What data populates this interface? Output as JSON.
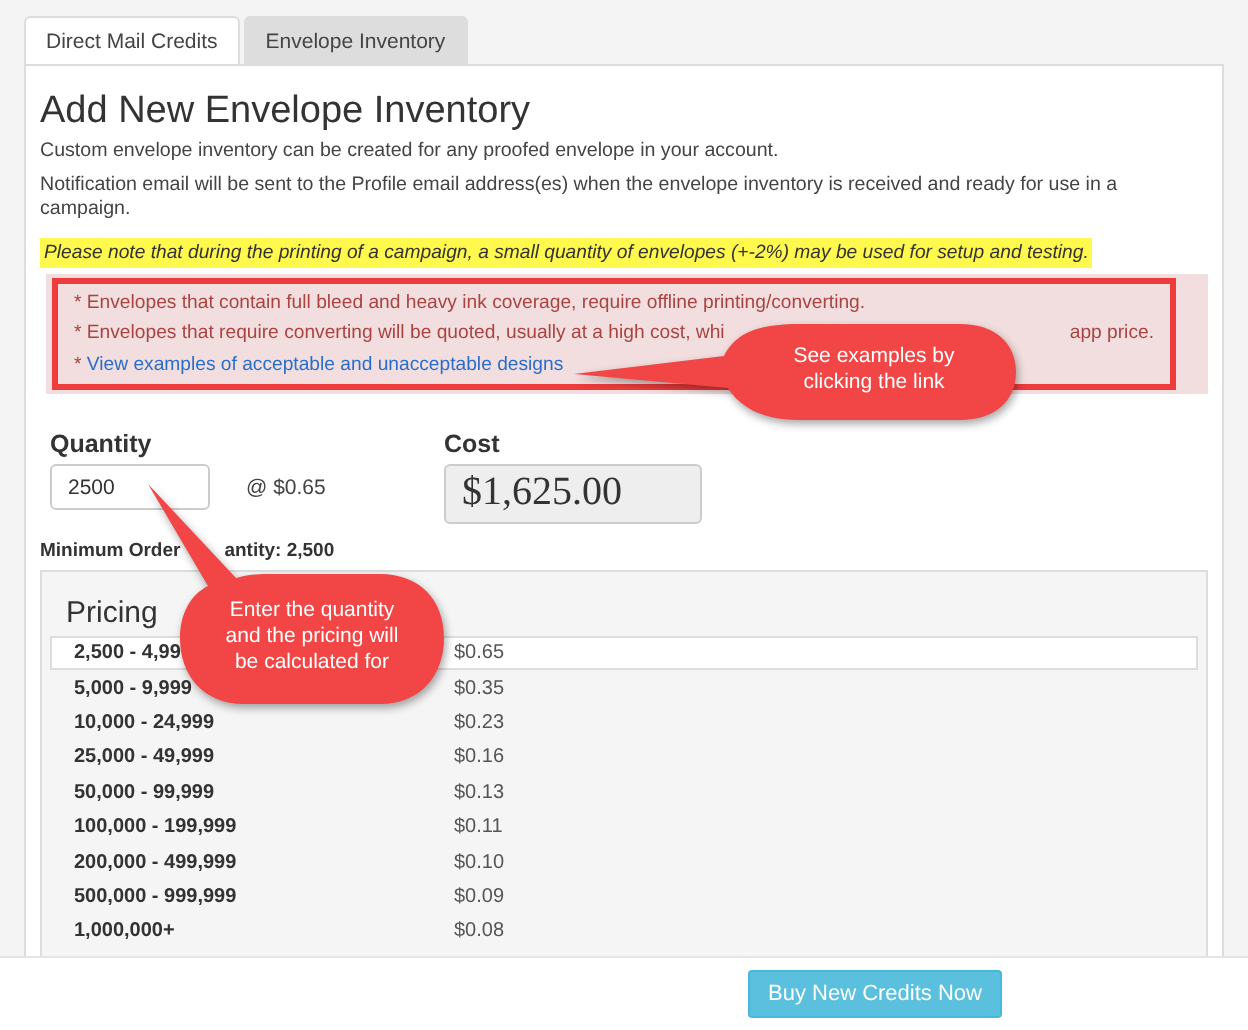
{
  "tabs": [
    {
      "label": "Direct Mail Credits",
      "selected": true
    },
    {
      "label": "Envelope Inventory",
      "selected": false
    }
  ],
  "heading": "Add New Envelope Inventory",
  "paragraphs": [
    "Custom envelope inventory can be created for any proofed envelope in your account.",
    "Notification email will be sent to the Profile email address(es) when the envelope inventory is received and ready for use in a campaign."
  ],
  "note": "Please note that during the printing of a campaign, a small quantity of envelopes (+-2%) may be used for setup and testing.",
  "warnings": [
    {
      "kind": "text",
      "parts": [
        "* Envelopes that contain full bleed and heavy ink coverage, require offline printing/converting."
      ]
    },
    {
      "kind": "text",
      "parts": [
        "* Envelopes that require converting will be quoted, usually at a high cost, whi",
        "app price."
      ]
    },
    {
      "kind": "link",
      "parts": [
        "* ",
        "View examples of acceptable and unacceptable designs"
      ]
    }
  ],
  "quantity": {
    "label": "Quantity",
    "value": "2500",
    "unit_price": "@ $0.65"
  },
  "cost": {
    "label": "Cost",
    "value": "$1,625.00"
  },
  "minimum": [
    "Minimum Order",
    "antity: 2,500"
  ],
  "pricing": {
    "title": "Pricing",
    "rows": [
      {
        "range": "2,500 - 4,99",
        "price": "$0.65",
        "selected": true
      },
      {
        "range": "5,000 - 9,999",
        "price": "$0.35",
        "selected": false
      },
      {
        "range": "10,000 - 24,999",
        "price": "$0.23",
        "selected": false
      },
      {
        "range": "25,000 - 49,999",
        "price": "$0.16",
        "selected": false
      },
      {
        "range": "50,000 - 99,999",
        "price": "$0.13",
        "selected": false
      },
      {
        "range": "100,000 - 199,999",
        "price": "$0.11",
        "selected": false
      },
      {
        "range": "200,000 - 499,999",
        "price": "$0.10",
        "selected": false
      },
      {
        "range": "500,000 - 999,999",
        "price": "$0.09",
        "selected": false
      },
      {
        "range": "1,000,000+",
        "price": "$0.08",
        "selected": false
      }
    ]
  },
  "callouts": [
    "See examples by clicking the link",
    "Enter the quantity and the pricing will be calculated for"
  ],
  "button": "Buy New Credits Now"
}
